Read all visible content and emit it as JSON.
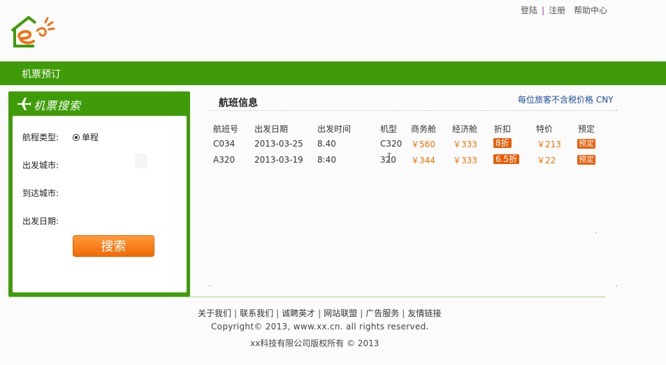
{
  "header": {
    "links": [
      "登陆",
      "注册",
      "帮助中心"
    ]
  },
  "nav": {
    "title": "机票预订"
  },
  "search": {
    "title": "机票搜索",
    "trip_type_label": "航程类型:",
    "trip_type_value": "单程",
    "from_label": "出发城市:",
    "to_label": "到达城市:",
    "date_label": "出发日期:",
    "button_label": "搜索"
  },
  "flights": {
    "title": "航班信息",
    "price_note": "每位旅客不含税价格 CNY",
    "columns": [
      "航班号",
      "出发日期",
      "出发时间",
      "机型",
      "商务舱",
      "经济舱",
      "折扣",
      "特价",
      "预定"
    ],
    "rows": [
      {
        "flight": "C034",
        "date": "2013-03-25",
        "time": "8.40",
        "model": "C320",
        "business": "￥560",
        "economy": "￥333",
        "discount": "8折",
        "special": "￥213",
        "book": "预定"
      },
      {
        "flight": "A320",
        "date": "2013-03-19",
        "time": "8:40",
        "model": "320",
        "business": "￥344",
        "economy": "￥333",
        "discount": "6.5折",
        "special": "￥22",
        "book": "预定"
      }
    ]
  },
  "footer": {
    "links": [
      "关于我们",
      "联系我们",
      "诚聘英才",
      "网站联盟",
      "广告服务",
      "友情链接"
    ],
    "copyright": "Copyright© 2013, www.xx.cn. all rights reserved.",
    "company": "xx科技有限公司版权所有 © 2013"
  },
  "colors": {
    "brand_green": "#3f9c08",
    "accent_orange": "#ef6f00",
    "link_blue": "#1f4e9c"
  }
}
